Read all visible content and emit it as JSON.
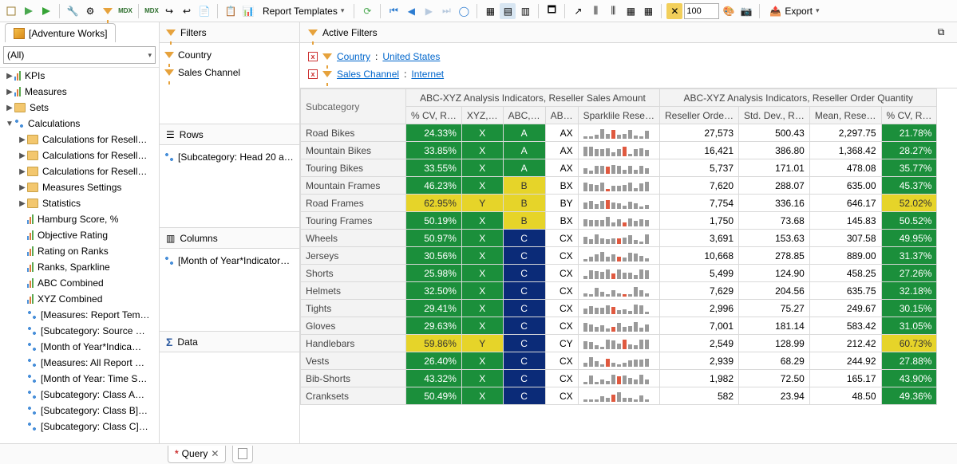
{
  "toolbar": {
    "report_templates": "Report Templates",
    "zoom": "100",
    "export": "Export"
  },
  "cube": {
    "name": "[Adventure Works]",
    "combo": "(All)",
    "tree": [
      {
        "tw": "▶",
        "depth": 0,
        "icon": "bars",
        "label": "KPIs"
      },
      {
        "tw": "▶",
        "depth": 0,
        "icon": "bars",
        "label": "Measures"
      },
      {
        "tw": "▶",
        "depth": 0,
        "icon": "folder",
        "label": "Sets"
      },
      {
        "tw": "▼",
        "depth": 0,
        "icon": "hier",
        "label": "Calculations"
      },
      {
        "tw": "▶",
        "depth": 1,
        "icon": "folder",
        "label": "Calculations for Resell…"
      },
      {
        "tw": "▶",
        "depth": 1,
        "icon": "folder",
        "label": "Calculations for Resell…"
      },
      {
        "tw": "▶",
        "depth": 1,
        "icon": "folder",
        "label": "Calculations for Resell…"
      },
      {
        "tw": "▶",
        "depth": 1,
        "icon": "folder",
        "label": "Measures Settings"
      },
      {
        "tw": "▶",
        "depth": 1,
        "icon": "folder",
        "label": "Statistics"
      },
      {
        "tw": "",
        "depth": 1,
        "icon": "bars",
        "label": "Hamburg Score, %"
      },
      {
        "tw": "",
        "depth": 1,
        "icon": "bars",
        "label": "Objective Rating"
      },
      {
        "tw": "",
        "depth": 1,
        "icon": "bars",
        "label": "Rating on Ranks"
      },
      {
        "tw": "",
        "depth": 1,
        "icon": "bars",
        "label": "Ranks, Sparkline"
      },
      {
        "tw": "",
        "depth": 1,
        "icon": "bars",
        "label": "ABC Combined"
      },
      {
        "tw": "",
        "depth": 1,
        "icon": "bars",
        "label": "XYZ Combined"
      },
      {
        "tw": "",
        "depth": 1,
        "icon": "hier",
        "label": "[Measures: Report Tem…"
      },
      {
        "tw": "",
        "depth": 1,
        "icon": "hier",
        "label": "[Subcategory: Source …"
      },
      {
        "tw": "",
        "depth": 1,
        "icon": "hier",
        "label": "[Month of Year*Indica…"
      },
      {
        "tw": "",
        "depth": 1,
        "icon": "hier",
        "label": "[Measures: All Report …"
      },
      {
        "tw": "",
        "depth": 1,
        "icon": "hier",
        "label": "[Month of Year: Time S…"
      },
      {
        "tw": "",
        "depth": 1,
        "icon": "hier",
        "label": "[Subcategory: Class A…"
      },
      {
        "tw": "",
        "depth": 1,
        "icon": "hier",
        "label": "[Subcategory: Class B]…"
      },
      {
        "tw": "",
        "depth": 1,
        "icon": "hier",
        "label": "[Subcategory: Class C]…"
      }
    ]
  },
  "design": {
    "filters_hdr": "Filters",
    "filters": [
      "Country",
      "Sales Channel"
    ],
    "rows_hdr": "Rows",
    "rows_item": "[Subcategory: Head 20 a…",
    "cols_hdr": "Columns",
    "cols_item": "[Month of Year*Indicator…",
    "data_hdr": "Data"
  },
  "active_filters": {
    "title": "Active Filters",
    "rows": [
      {
        "label": "Country",
        "value": "United States"
      },
      {
        "label": "Sales Channel",
        "value": "Internet"
      }
    ]
  },
  "grid": {
    "subhdr": "Subcategory",
    "group1": "ABC-XYZ Analysis Indicators, Reseller Sales Amount",
    "group2": "ABC-XYZ Analysis Indicators, Reseller Order Quantity",
    "cols1": [
      "% CV, R…",
      "XYZ,…",
      "ABC,…",
      "AB…",
      "Sparklile Rese…"
    ],
    "cols2": [
      "Reseller Orde…",
      "Std. Dev., R…",
      "Mean, Rese…",
      "% CV, R…"
    ],
    "rows": [
      {
        "sub": "Road Bikes",
        "cv": "24.33%",
        "xyz": "X",
        "abc": "A",
        "ab": "AX",
        "ro": "27,573",
        "sd": "500.43",
        "mn": "2,297.75",
        "cv2": "21.78%",
        "cv2c": "g"
      },
      {
        "sub": "Mountain Bikes",
        "cv": "33.85%",
        "xyz": "X",
        "abc": "A",
        "ab": "AX",
        "ro": "16,421",
        "sd": "386.80",
        "mn": "1,368.42",
        "cv2": "28.27%",
        "cv2c": "g"
      },
      {
        "sub": "Touring Bikes",
        "cv": "33.55%",
        "xyz": "X",
        "abc": "A",
        "ab": "AX",
        "ro": "5,737",
        "sd": "171.01",
        "mn": "478.08",
        "cv2": "35.77%",
        "cv2c": "g"
      },
      {
        "sub": "Mountain Frames",
        "cv": "46.23%",
        "xyz": "X",
        "abc": "B",
        "abcC": "y",
        "ab": "BX",
        "ro": "7,620",
        "sd": "288.07",
        "mn": "635.00",
        "cv2": "45.37%",
        "cv2c": "g"
      },
      {
        "sub": "Road Frames",
        "cv": "62.95%",
        "cvC": "y",
        "xyz": "Y",
        "xyzC": "y",
        "abc": "B",
        "abcC": "y",
        "ab": "BY",
        "ro": "7,754",
        "sd": "336.16",
        "mn": "646.17",
        "cv2": "52.02%",
        "cv2c": "y"
      },
      {
        "sub": "Touring Frames",
        "cv": "50.19%",
        "xyz": "X",
        "abc": "B",
        "abcC": "y",
        "ab": "BX",
        "ro": "1,750",
        "sd": "73.68",
        "mn": "145.83",
        "cv2": "50.52%",
        "cv2c": "g"
      },
      {
        "sub": "Wheels",
        "cv": "50.97%",
        "xyz": "X",
        "abc": "C",
        "abcC": "b",
        "ab": "CX",
        "ro": "3,691",
        "sd": "153.63",
        "mn": "307.58",
        "cv2": "49.95%",
        "cv2c": "g"
      },
      {
        "sub": "Jerseys",
        "cv": "30.56%",
        "xyz": "X",
        "abc": "C",
        "abcC": "b",
        "ab": "CX",
        "ro": "10,668",
        "sd": "278.85",
        "mn": "889.00",
        "cv2": "31.37%",
        "cv2c": "g"
      },
      {
        "sub": "Shorts",
        "cv": "25.98%",
        "xyz": "X",
        "abc": "C",
        "abcC": "b",
        "ab": "CX",
        "ro": "5,499",
        "sd": "124.90",
        "mn": "458.25",
        "cv2": "27.26%",
        "cv2c": "g"
      },
      {
        "sub": "Helmets",
        "cv": "32.50%",
        "xyz": "X",
        "abc": "C",
        "abcC": "b",
        "ab": "CX",
        "ro": "7,629",
        "sd": "204.56",
        "mn": "635.75",
        "cv2": "32.18%",
        "cv2c": "g"
      },
      {
        "sub": "Tights",
        "cv": "29.41%",
        "xyz": "X",
        "abc": "C",
        "abcC": "b",
        "ab": "CX",
        "ro": "2,996",
        "sd": "75.27",
        "mn": "249.67",
        "cv2": "30.15%",
        "cv2c": "g"
      },
      {
        "sub": "Gloves",
        "cv": "29.63%",
        "xyz": "X",
        "abc": "C",
        "abcC": "b",
        "ab": "CX",
        "ro": "7,001",
        "sd": "181.14",
        "mn": "583.42",
        "cv2": "31.05%",
        "cv2c": "g"
      },
      {
        "sub": "Handlebars",
        "cv": "59.86%",
        "cvC": "y",
        "xyz": "Y",
        "xyzC": "y",
        "abc": "C",
        "abcC": "b",
        "ab": "CY",
        "ro": "2,549",
        "sd": "128.99",
        "mn": "212.42",
        "cv2": "60.73%",
        "cv2c": "y"
      },
      {
        "sub": "Vests",
        "cv": "26.40%",
        "xyz": "X",
        "abc": "C",
        "abcC": "b",
        "ab": "CX",
        "ro": "2,939",
        "sd": "68.29",
        "mn": "244.92",
        "cv2": "27.88%",
        "cv2c": "g"
      },
      {
        "sub": "Bib-Shorts",
        "cv": "43.32%",
        "xyz": "X",
        "abc": "C",
        "abcC": "b",
        "ab": "CX",
        "ro": "1,982",
        "sd": "72.50",
        "mn": "165.17",
        "cv2": "43.90%",
        "cv2c": "g"
      },
      {
        "sub": "Cranksets",
        "cv": "50.49%",
        "xyz": "X",
        "abc": "C",
        "abcC": "b",
        "ab": "CX",
        "ro": "582",
        "sd": "23.94",
        "mn": "48.50",
        "cv2": "49.36%",
        "cv2c": "g"
      }
    ]
  },
  "bottom": {
    "query_tab": "Query"
  }
}
